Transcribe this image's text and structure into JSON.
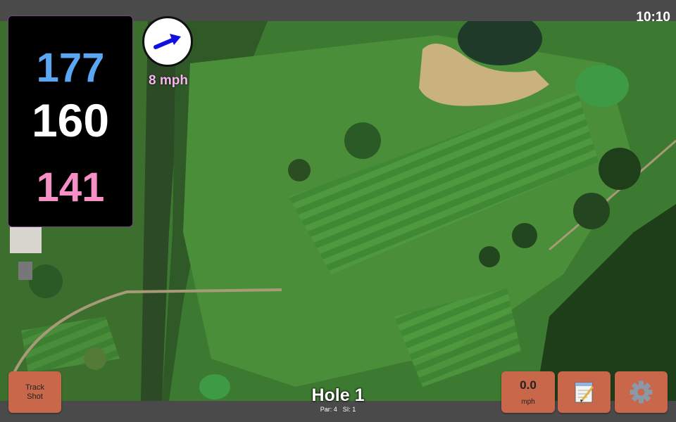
{
  "status_bar": {
    "time": "10:10"
  },
  "distances": {
    "back": "177",
    "middle": "160",
    "front": "141"
  },
  "wind": {
    "speed": "8 mph",
    "arrow_color": "#1010e0"
  },
  "hole": {
    "title": "Hole 1",
    "par": "Par: 4",
    "stroke_index": "SI: 1"
  },
  "buttons": {
    "track_shot": "Track Shot",
    "speed_value": "0.0",
    "speed_unit": "mph",
    "notes_icon": "notepad-icon",
    "settings_icon": "gear-icon"
  },
  "colors": {
    "button_bg": "#c8674a",
    "back_distance": "#5aa6f2",
    "middle_distance": "#ffffff",
    "front_distance": "#f58fc6",
    "wind_text": "#f8b6ef"
  }
}
